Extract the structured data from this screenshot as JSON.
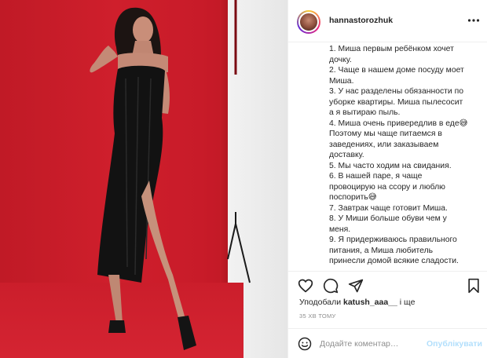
{
  "post": {
    "username": "hannastorozhuk",
    "caption_lines": [
      "1. Миша первым ребёнком хочет",
      "дочку.",
      "2. Чаще в нашем доме посуду моет",
      "Миша.",
      "3. У нас разделены обязанности по",
      "уборке квартиры. Миша пылесосит",
      "а я вытираю пыль.",
      "4. Миша очень привередлив в еде😅",
      "Поэтому мы чаще питаемся в",
      "заведениях, или заказываем",
      "доставку.",
      "5. Мы часто ходим на свидания.",
      "6. В нашей паре, я чаще",
      "провоцирую на ссору и люблю",
      "поспорить😅",
      "7. Завтрак чаще готовит Миша.",
      "8. У Миши больше обуви чем у",
      "меня.",
      "9. Я придерживаюсь правильного",
      "питания, а Миша любитель",
      "принесли домой всякие сладости."
    ],
    "likes": {
      "prefix": "Уподобали ",
      "user": "katush_aaa__",
      "suffix": " і ще"
    },
    "time_ago": "35 ХВ ТОМУ",
    "comment": {
      "placeholder": "Додайте коментар…",
      "post_label": "Опублікувати"
    }
  },
  "icons": {
    "more": "more-horizontal-icon",
    "like": "heart-icon",
    "comment": "comment-icon",
    "share": "paper-plane-icon",
    "save": "bookmark-icon",
    "emoji": "smile-icon"
  },
  "colors": {
    "backdrop_red": "#cf1f2c",
    "link_blue_disabled": "#b2dffc",
    "muted_text": "#8e8e8e"
  }
}
